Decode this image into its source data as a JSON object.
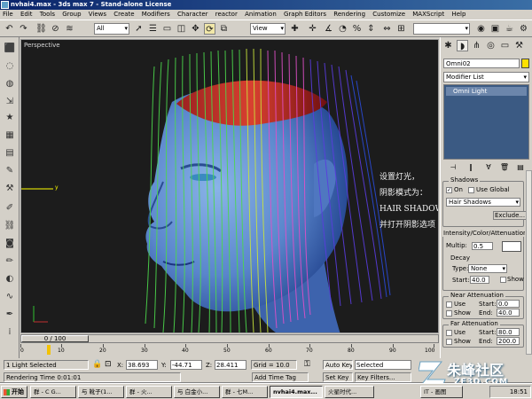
{
  "window": {
    "title": "nvhai4.max - 3ds max 7  - Stand-alone License"
  },
  "menu": [
    "File",
    "Edit",
    "Tools",
    "Group",
    "Views",
    "Create",
    "Modifiers",
    "Character",
    "reactor",
    "Animation",
    "Graph Editors",
    "Rendering",
    "Customize",
    "MAXScript",
    "Help"
  ],
  "toolbar": {
    "selection_filter": "All",
    "reference_coord": "View"
  },
  "viewport": {
    "label": "Perspective",
    "annotation": [
      "设置灯光，",
      "阴影模式为：",
      "HAIR SHADOWS",
      "并打开阴影选项"
    ]
  },
  "command_panel": {
    "object_name": "Omni02",
    "object_color": "#ffe000",
    "modifier_list": "Modifier List",
    "stack_item": "Omni Light",
    "shadows": {
      "title": "Shadows",
      "on_label": "On",
      "use_global_label": "Use Global",
      "type": "Hair Shadows",
      "exclude_label": "Exclude..."
    },
    "intensity": {
      "title": "Intensity/Color/Attenuation",
      "multiplier_label": "Multip:",
      "multiplier": "0.5",
      "decay_title": "Decay",
      "type_label": "Type:",
      "type": "None",
      "start_label": "Start:",
      "start": "40.0",
      "show_label": "Show"
    },
    "near_atten": {
      "title": "Near Attenuation",
      "use_label": "Use",
      "show_label": "Show",
      "start_label": "Start:",
      "start": "0.0",
      "end_label": "End:",
      "end": "40.0"
    },
    "far_atten": {
      "title": "Far Attenuation",
      "use_label": "Use",
      "show_label": "Show",
      "start_label": "Start:",
      "start": "80.0",
      "end_label": "End:",
      "end": "200.0"
    }
  },
  "timeline": {
    "frame_display": "0 / 100",
    "ticks": [
      "0",
      "10",
      "20",
      "30",
      "40",
      "50",
      "60",
      "70",
      "80",
      "90",
      "100"
    ]
  },
  "status": {
    "selection": "1 Light Selected",
    "x_label": "X:",
    "x": "38.693",
    "y_label": "Y:",
    "y": "-44.71",
    "z_label": "Z:",
    "z": "28.411",
    "grid": "Grid = 10.0",
    "autokey": "Auto Key",
    "key_filter": "Selected",
    "setkey": "Set Key",
    "key_filters": "Key Filters...",
    "render_time": "Rendering Time  0:01:01",
    "add_time_tag": "Add Time Tag"
  },
  "taskbar": {
    "start": "开始",
    "tasks": [
      "群 - C G...",
      "与 靴子(1...",
      "群 - 火...",
      "与 白金小...",
      "群 - 七M...",
      "nvhai4.max...",
      "火星时代...",
      "IT - 画图"
    ],
    "clock": "18:51"
  },
  "watermark": {
    "text": "朱峰社区",
    "url": "ZF3D.COM"
  }
}
